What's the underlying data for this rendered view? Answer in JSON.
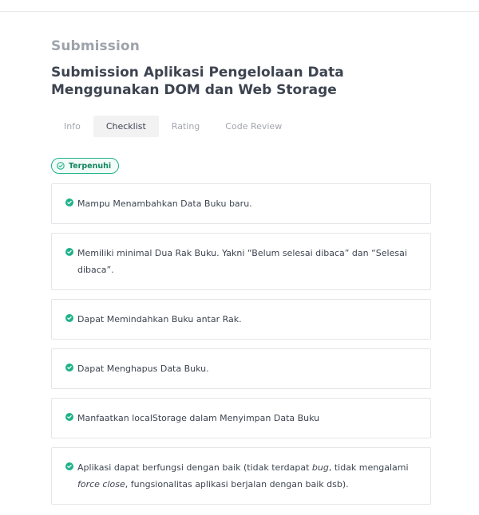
{
  "section_label": "Submission",
  "title": "Submission Aplikasi Pengelolaan Data Menggunakan DOM dan Web Storage",
  "tabs": [
    {
      "label": "Info",
      "active": false
    },
    {
      "label": "Checklist",
      "active": true
    },
    {
      "label": "Rating",
      "active": false
    },
    {
      "label": "Code Review",
      "active": false
    }
  ],
  "status": {
    "label": "Terpenuhi",
    "icon": "check-circle-outline-icon",
    "color": "#1fb28a"
  },
  "checklist": {
    "icon": "check-circle-filled-icon",
    "items": [
      {
        "text": "Mampu Menambahkan Data Buku baru."
      },
      {
        "text": "Memiliki minimal Dua Rak Buku. Yakni “Belum selesai dibaca” dan “Selesai dibaca”."
      },
      {
        "text": "Dapat Memindahkan Buku antar Rak."
      },
      {
        "text": "Dapat Menghapus Data Buku."
      },
      {
        "text": "Manfaatkan localStorage dalam Menyimpan Data Buku"
      },
      {
        "parts": [
          {
            "text": "Aplikasi dapat berfungsi dengan baik (tidak terdapat ",
            "italic": false
          },
          {
            "text": "bug",
            "italic": true
          },
          {
            "text": ", tidak mengalami ",
            "italic": false
          },
          {
            "text": "force close",
            "italic": true
          },
          {
            "text": ", fungsionalitas aplikasi berjalan dengan baik dsb).",
            "italic": false
          }
        ]
      }
    ]
  }
}
